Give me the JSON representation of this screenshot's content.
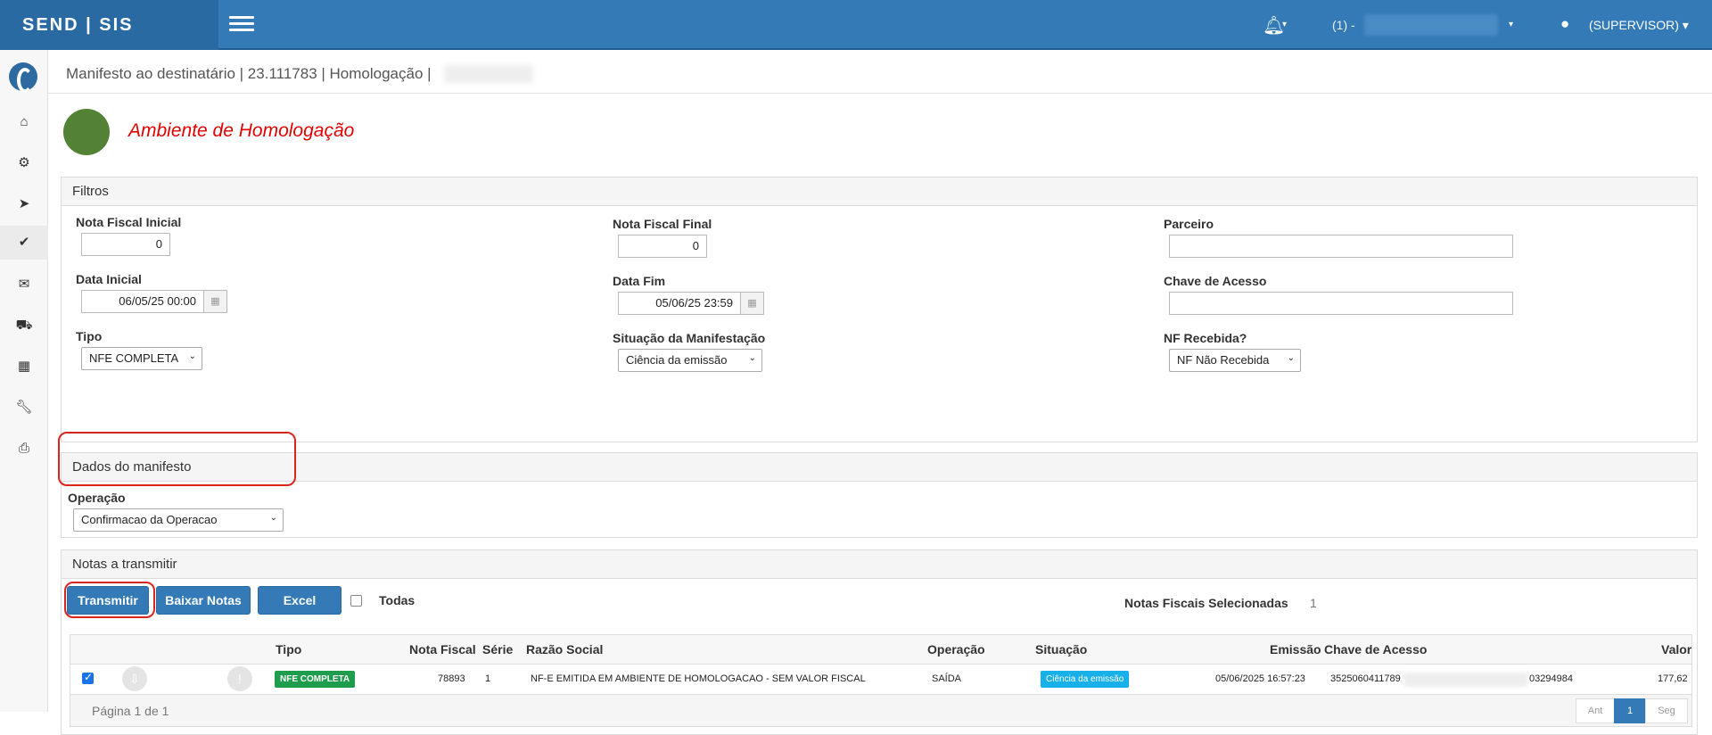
{
  "topbar": {
    "brand": "SEND | SIS",
    "company_prefix": "(1) -",
    "user": "(SUPERVISOR) ▾"
  },
  "sidebar": {
    "icons": [
      "home-icon",
      "gears-icon",
      "paper-plane-icon",
      "double-check-icon",
      "envelope-icon",
      "truck-icon",
      "map-icon",
      "wrench-icon",
      "print-icon"
    ],
    "active_index": 3
  },
  "header": {
    "breadcrumb": "Manifesto ao destinatário | 23.111783 | Homologação |",
    "environment": "Ambiente de Homologação",
    "environment_color": "#538135"
  },
  "filtros": {
    "title": "Filtros",
    "nf_inicial_label": "Nota Fiscal Inicial",
    "nf_inicial_value": "0",
    "nf_final_label": "Nota Fiscal Final",
    "nf_final_value": "0",
    "parceiro_label": "Parceiro",
    "parceiro_value": "",
    "data_inicial_label": "Data Inicial",
    "data_inicial_value": "06/05/25 00:00",
    "data_fim_label": "Data Fim",
    "data_fim_value": "05/06/25 23:59",
    "chave_label": "Chave de Acesso",
    "chave_value": "",
    "tipo_label": "Tipo",
    "tipo_value": "NFE COMPLETA",
    "situacao_label": "Situação da Manifestação",
    "situacao_value": "Ciência da emissão",
    "nf_recebida_label": "NF Recebida?",
    "nf_recebida_value": "NF Não Recebida"
  },
  "manifesto": {
    "title": "Dados do manifesto",
    "operacao_label": "Operação",
    "operacao_value": "Confirmacao da Operacao"
  },
  "notas": {
    "title": "Notas a transmitir",
    "transmitir": "Transmitir",
    "baixar": "Baixar Notas",
    "excel": "Excel",
    "todas": "Todas",
    "selecionadas_label": "Notas Fiscais Selecionadas",
    "selecionadas_count": "1",
    "columns": {
      "tipo": "Tipo",
      "nota_fiscal": "Nota Fiscal",
      "serie": "Série",
      "razao": "Razão Social",
      "operacao": "Operação",
      "situacao": "Situação",
      "emissao": "Emissão",
      "chave": "Chave de Acesso",
      "valor": "Valor"
    },
    "rows": [
      {
        "checked": true,
        "tipo": "NFE COMPLETA",
        "nota_fiscal": "78893",
        "serie": "1",
        "razao": "NF-E EMITIDA EM AMBIENTE DE HOMOLOGACAO - SEM VALOR FISCAL",
        "operacao": "SAÍDA",
        "situacao": "Ciência da emissão",
        "emissao": "05/06/2025 16:57:23",
        "chave_start": "3525060411789",
        "chave_end": "03294984",
        "valor": "177,62"
      }
    ],
    "pagination": {
      "info": "Página 1 de 1",
      "prev": "Ant",
      "current": "1",
      "next": "Seg"
    }
  }
}
